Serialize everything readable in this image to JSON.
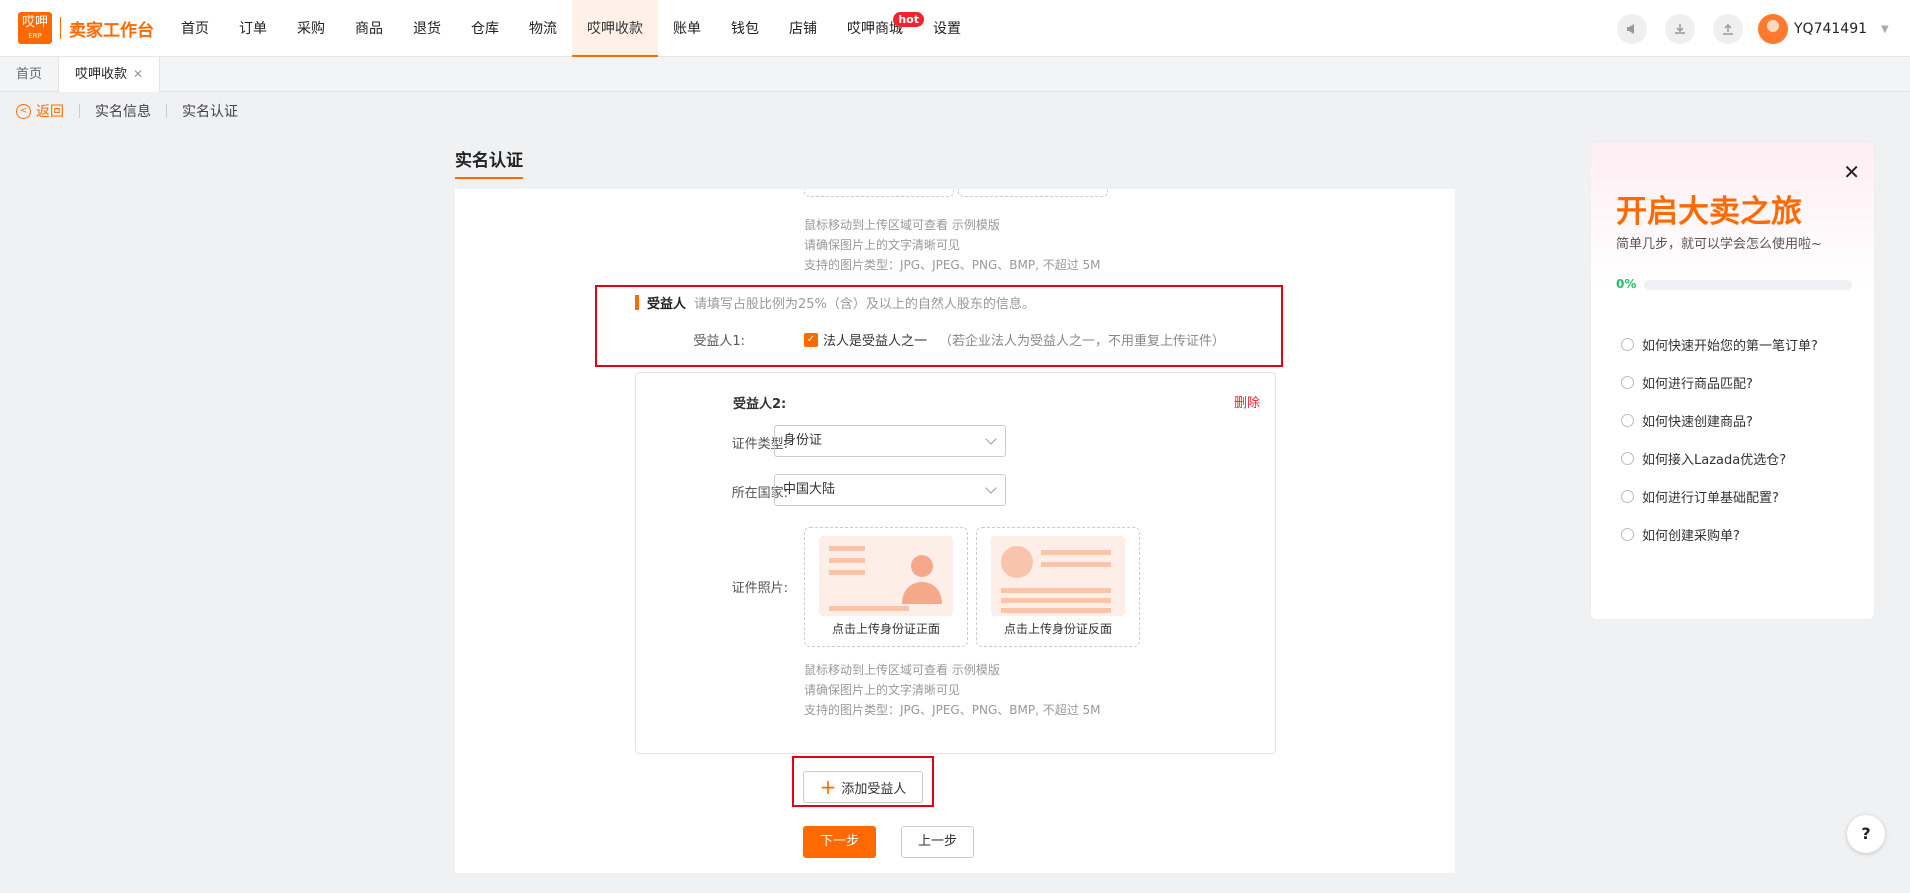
{
  "header": {
    "logo_mark": "哎呷",
    "logo_sub": "ERP",
    "app_title": "卖家工作台",
    "nav": [
      {
        "label": "首页"
      },
      {
        "label": "订单"
      },
      {
        "label": "采购"
      },
      {
        "label": "商品"
      },
      {
        "label": "退货"
      },
      {
        "label": "仓库"
      },
      {
        "label": "物流"
      },
      {
        "label": "哎呷收款",
        "active": true
      },
      {
        "label": "账单"
      },
      {
        "label": "钱包"
      },
      {
        "label": "店铺"
      },
      {
        "label": "哎呷商城",
        "badge": "hot"
      },
      {
        "label": "设置"
      }
    ],
    "icons": [
      "megaphone-icon",
      "download-icon",
      "upload-icon"
    ],
    "user_name": "YQ741491"
  },
  "tabs": [
    {
      "label": "首页"
    },
    {
      "label": "哎呷收款",
      "active": true,
      "closable": true
    }
  ],
  "breadcrumb": {
    "back_label": "返回",
    "items": [
      "实名信息",
      "实名认证"
    ]
  },
  "page_title": "实名认证",
  "form": {
    "upload_hints": [
      "鼠标移动到上传区域可查看 示例模版",
      "请确保图片上的文字清晰可见",
      "支持的图片类型：JPG、JPEG、PNG、BMP, 不超过 5M"
    ],
    "beneficiary_section": {
      "title": "受益人",
      "description": "请填写占股比例为25%（含）及以上的自然人股东的信息。",
      "b1_label": "受益人1:",
      "b1_checkbox_label": "法人是受益人之一",
      "b1_checked": true,
      "b1_note": "（若企业法人为受益人之一，不用重复上传证件）"
    },
    "beneficiary2": {
      "title": "受益人2:",
      "delete_label": "删除",
      "id_type_label": "证件类型:",
      "id_type_value": "身份证",
      "country_label": "所在国家:",
      "country_value": "中国大陆",
      "photo_label": "证件照片:",
      "front_caption": "点击上传身份证正面",
      "back_caption": "点击上传身份证反面"
    },
    "add_button": "添加受益人",
    "next_button": "下一步",
    "prev_button": "上一步"
  },
  "guide": {
    "title": "开启大卖之旅",
    "subtitle": "简单几步，就可以学会怎么使用啦~",
    "progress": "0%",
    "progress_value": 0,
    "items": [
      "如何快速开始您的第一笔订单?",
      "如何进行商品匹配?",
      "如何快速创建商品?",
      "如何接入Lazada优选仓?",
      "如何进行订单基础配置?",
      "如何创建采购单?"
    ]
  },
  "help_label": "?",
  "colors": {
    "accent": "#ff6a00",
    "danger": "#f5222d",
    "success": "#26c15e",
    "highlight": "#e60012"
  }
}
